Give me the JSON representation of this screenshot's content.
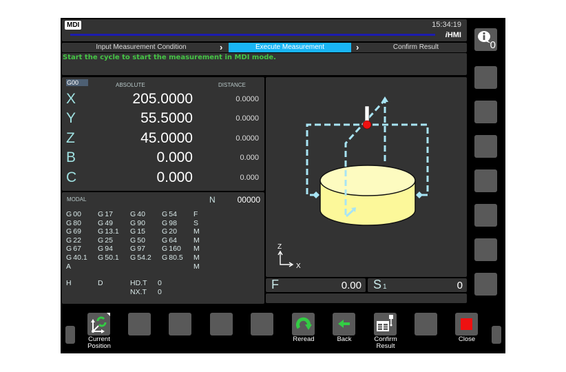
{
  "header": {
    "mode": "MDI",
    "clock": "15:34:19",
    "brand_prefix": "i",
    "brand_suffix": "HMI"
  },
  "steps": [
    {
      "label": "Input Measurement Condition",
      "active": false
    },
    {
      "label": "Execute Measurement",
      "active": true
    },
    {
      "label": "Confirm Result",
      "active": false
    }
  ],
  "message": "Start the cycle to start the measurement in MDI mode.",
  "position": {
    "gcode": "G00",
    "absolute_label": "ABSOLUTE",
    "distance_label": "DISTANCE",
    "axes": [
      {
        "name": "X",
        "absolute": "205.0000",
        "distance": "0.0000"
      },
      {
        "name": "Y",
        "absolute": "55.5000",
        "distance": "0.0000"
      },
      {
        "name": "Z",
        "absolute": "45.0000",
        "distance": "0.0000"
      },
      {
        "name": "B",
        "absolute": "0.000",
        "distance": "0.000"
      },
      {
        "name": "C",
        "absolute": "0.000",
        "distance": "0.000"
      }
    ]
  },
  "modal": {
    "title": "MODAL",
    "n_label": "N",
    "n_value": "00000",
    "columns": [
      [
        "G00",
        "G80",
        "G69",
        "G22",
        "G67",
        "G40.1",
        "A"
      ],
      [
        "G17",
        "G49",
        "G13.1",
        "G25",
        "G94",
        "G50.1"
      ],
      [
        "G40",
        "G90",
        "G15",
        "G50",
        "G97",
        "G54.2"
      ],
      [
        "G54",
        "G98",
        "G20",
        "G64",
        "G160",
        "G80.5"
      ],
      [
        "F",
        "S",
        "M",
        "M",
        "M",
        "M",
        "M"
      ]
    ],
    "h_label": "H",
    "d_label": "D",
    "hdt_label": "HD.T",
    "hdt_value": "0",
    "nxt_label": "NX.T",
    "nxt_value": "0"
  },
  "view": {
    "axis_z": "Z",
    "axis_x": "X",
    "colors": {
      "workpiece": "#fcf89a",
      "path": "#a8e4f4",
      "probe_ball": "#ee1111"
    }
  },
  "feed": {
    "label": "F",
    "value": "0.00"
  },
  "spindle": {
    "label": "S",
    "index": "1",
    "value": "0"
  },
  "info": {
    "count": "0"
  },
  "softkeys": [
    {
      "label_1": "Current",
      "label_2": "Position",
      "icon": "current-position-icon"
    },
    {
      "label_1": "",
      "label_2": "",
      "icon": ""
    },
    {
      "label_1": "",
      "label_2": "",
      "icon": ""
    },
    {
      "label_1": "",
      "label_2": "",
      "icon": ""
    },
    {
      "label_1": "",
      "label_2": "",
      "icon": ""
    },
    {
      "label_1": "Reread",
      "label_2": "",
      "icon": "reread-icon"
    },
    {
      "label_1": "Back",
      "label_2": "",
      "icon": "back-arrow-icon"
    },
    {
      "label_1": "Confirm",
      "label_2": "Result",
      "icon": "confirm-result-icon"
    },
    {
      "label_1": "",
      "label_2": "",
      "icon": ""
    },
    {
      "label_1": "Close",
      "label_2": "",
      "icon": "close-icon"
    }
  ],
  "colors": {
    "active_step": "#19b5f5",
    "message_text": "#45c545",
    "progress_bar": "#1c1cb0"
  }
}
